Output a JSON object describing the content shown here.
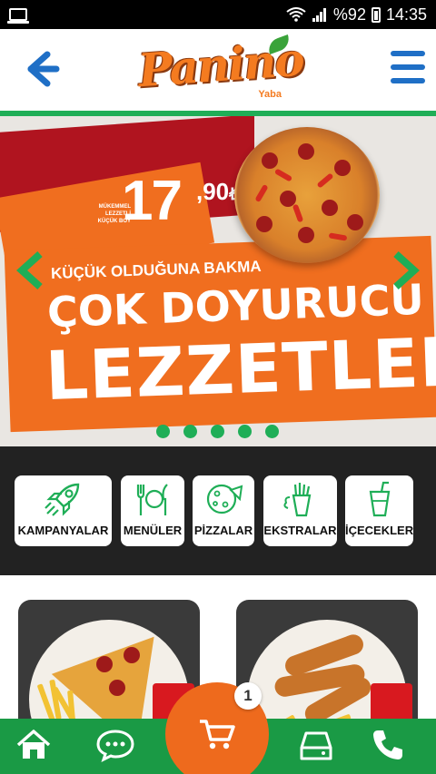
{
  "status_bar": {
    "battery": "%92",
    "time": "14:35"
  },
  "header": {
    "logo_text": "Panino",
    "logo_sub": "Yaba"
  },
  "banner": {
    "price_small": "MÜKEMMEL LEZZETLİ KÜÇÜK BOY",
    "price_whole": "17",
    "price_cents": ",90",
    "currency": "₺",
    "headline_small": "KÜÇÜK OLDUĞUNA BAKMA",
    "headline_line1": "ÇOK DOYURUCU",
    "headline_line2": "LEZZETLER",
    "active_slide": 0,
    "slide_count": 5
  },
  "categories": [
    {
      "label": "KAMPANYALAR",
      "icon": "rocket-icon"
    },
    {
      "label": "MENÜLER",
      "icon": "cutlery-icon"
    },
    {
      "label": "PİZZALAR",
      "icon": "pizza-icon"
    },
    {
      "label": "EKSTRALAR",
      "icon": "fries-icon"
    },
    {
      "label": "İÇECEKLER",
      "icon": "drink-icon"
    }
  ],
  "cart": {
    "count": "1"
  },
  "bottom_nav": [
    {
      "icon": "home-icon"
    },
    {
      "icon": "chat-icon"
    },
    {
      "icon": "cart-icon"
    },
    {
      "icon": "drive-icon"
    },
    {
      "icon": "phone-icon"
    }
  ],
  "colors": {
    "green": "#1fae57",
    "orange": "#f06e1f",
    "red": "#b0141f",
    "blue": "#1f6fc6",
    "dark": "#222222"
  }
}
